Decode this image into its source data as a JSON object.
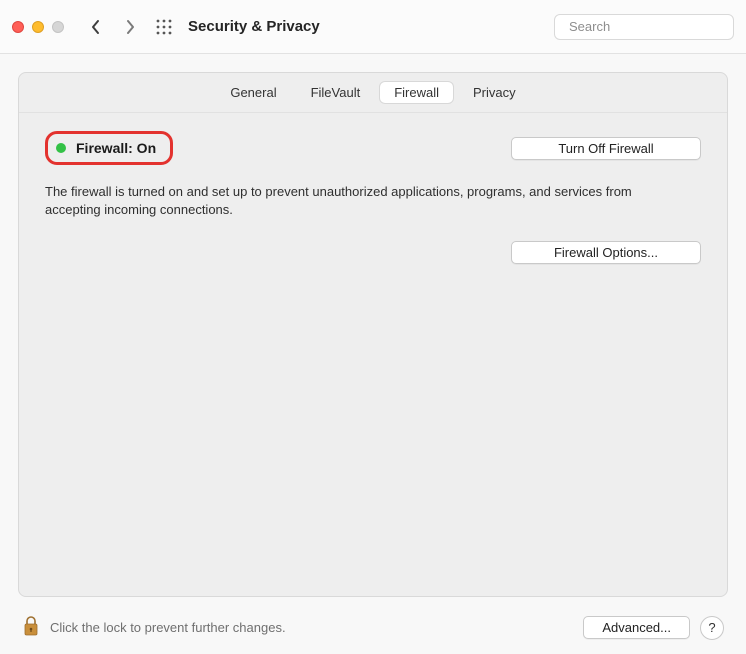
{
  "window": {
    "title": "Security & Privacy"
  },
  "search": {
    "placeholder": "Search",
    "value": ""
  },
  "tabs": {
    "general": "General",
    "filevault": "FileVault",
    "firewall": "Firewall",
    "privacy": "Privacy",
    "active": "firewall"
  },
  "firewall": {
    "statusLabel": "Firewall: On",
    "statusColor": "#33c146",
    "turnOffLabel": "Turn Off Firewall",
    "description": "The firewall is turned on and set up to prevent unauthorized applications, programs, and services from accepting incoming connections.",
    "optionsLabel": "Firewall Options..."
  },
  "footer": {
    "lockText": "Click the lock to prevent further changes.",
    "advancedLabel": "Advanced...",
    "helpLabel": "?"
  }
}
